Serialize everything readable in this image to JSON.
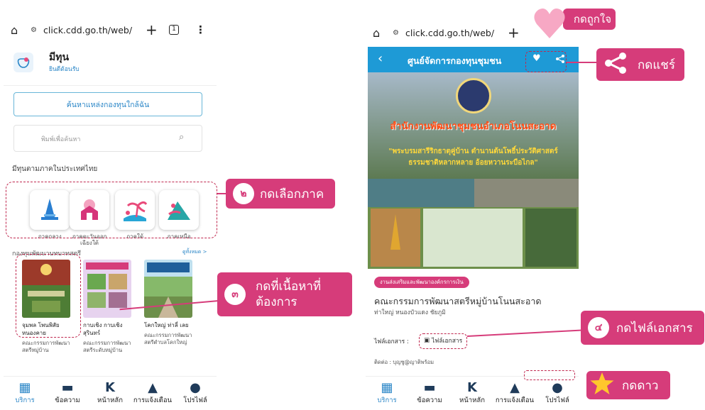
{
  "left": {
    "browser": {
      "url": "click.cdd.go.th/web/",
      "tab_count": "1"
    },
    "app": {
      "name": "มีทุน",
      "greeting": "ยินดีต้อนรับ"
    },
    "nearby_button": "ค้นหาแหล่งกองทุนใกล้ฉัน",
    "search_placeholder": "พิมพ์เพื่อค้นหา",
    "region_heading": "มีทุนตามภาคในประเทศไทย",
    "regions": [
      {
        "label": "ภาคกลาง",
        "color": "#2a7fd1"
      },
      {
        "label": "ภาคตะวันออกเฉียงใต้",
        "color": "#d6357a"
      },
      {
        "label": "ภาคใต้",
        "color": "#e94a7a"
      },
      {
        "label": "ภาคเหนือ",
        "color": "#28a6a6"
      }
    ],
    "section_heading": "กองทุนพัฒนาบทบาทสตรี",
    "view_all": "ดูทั้งหมด >",
    "cards": [
      {
        "place": "จุมพล โพนพิสัย หนองคาย",
        "org": "คณะกรรมการพัฒนาสตรีหมู่บ้าน"
      },
      {
        "place": "กาบเชิง กาบเชิง สุรินทร์",
        "org": "คณะกรรมการพัฒนาสตรีระดับหมู่บ้าน"
      },
      {
        "place": "โคกใหญ่ ท่าลี่ เลย",
        "org": "คณะกรรมการพัฒนาสตรีตำบลโคกใหญ่"
      }
    ]
  },
  "right": {
    "browser": {
      "url": "click.cdd.go.th/web/"
    },
    "header_title": "ศูนย์จัดการกองทุนชุมชน",
    "poster": {
      "title": "สำนักงานพัฒนาชุมชนอำเภอโนนสะอาด",
      "line1": "\"พระบรมสารีริกธาตุคู่บ้าน ตำนานต้นโพธิ์ประวัติศาสตร์",
      "line2": "ธรรมชาติหลากหลาย อ้อยหวานระบือไกล\""
    },
    "tag": "งานส่งเสริมและพัฒนาองค์กรการเงิน",
    "org_title": "คณะกรรมการพัฒนาสตรีหมู่บ้านโนนสะอาด",
    "location": "ท่าใหญ่ หนองบัวแดง ชัยภูมิ",
    "file_label": "ไฟล์เอกสาร :",
    "file_button": "ไฟล์เอกสาร",
    "contact": "ติดต่อ : บุญชู@ญาติพร้อม"
  },
  "nav": [
    {
      "label": "บริการ",
      "icon": "grid-icon"
    },
    {
      "label": "ข้อความ",
      "icon": "message-icon"
    },
    {
      "label": "หน้าหลัก",
      "icon": "home-logo-icon"
    },
    {
      "label": "การแจ้งเตือน",
      "icon": "bell-icon"
    },
    {
      "label": "โปรไฟล์",
      "icon": "profile-icon"
    }
  ],
  "callouts": {
    "like": "กดถูกใจ",
    "share": "กดแชร์",
    "region": {
      "number": "๒",
      "text": "กดเลือกภาค"
    },
    "content": {
      "number": "๓",
      "line1": "กดที่เนื้อหาที่",
      "line2": "ต้องการ"
    },
    "file": {
      "number": "๔",
      "text": "กดไฟล์เอกสาร"
    },
    "star": "กดดาว"
  },
  "colors": {
    "accent": "#d63c7a",
    "header": "#1e9ad6",
    "nav_active": "#2a86c7"
  }
}
